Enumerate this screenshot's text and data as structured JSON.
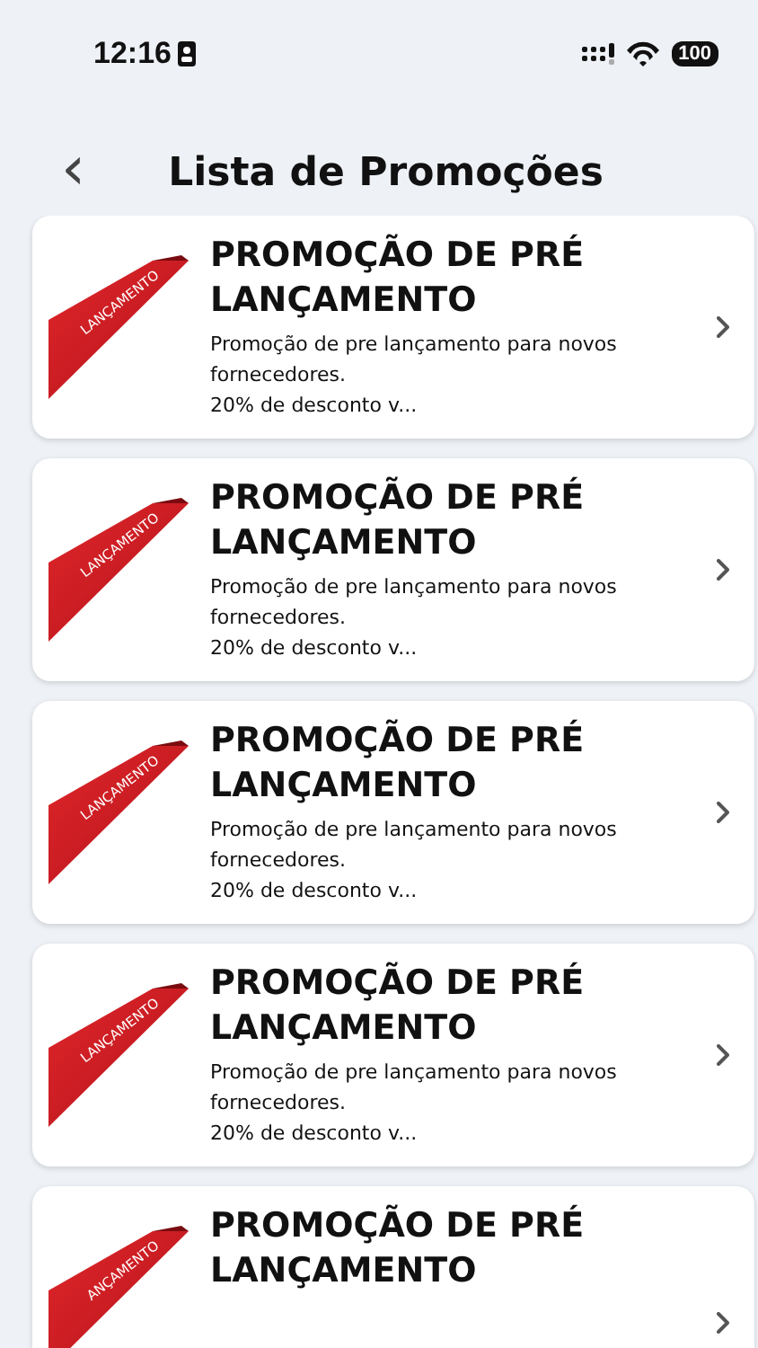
{
  "status_bar": {
    "time": "12:16",
    "battery": "100"
  },
  "header": {
    "back": "‹",
    "title": "Lista de Promoções"
  },
  "promotions": [
    {
      "ribbon": "LANÇAMENTO",
      "title": "PROMOÇÃO DE PRÉ LANÇAMENTO",
      "description": [
        "Promoção de pre lançamento para novos fornecedores.",
        "20% de desconto v..."
      ]
    },
    {
      "ribbon": "LANÇAMENTO",
      "title": "PROMOÇÃO DE PRÉ LANÇAMENTO",
      "description": [
        "Promoção de pre lançamento para novos fornecedores.",
        "20% de desconto v..."
      ]
    },
    {
      "ribbon": "LANÇAMENTO",
      "title": "PROMOÇÃO DE PRÉ LANÇAMENTO",
      "description": [
        "Promoção de pre lançamento para novos fornecedores.",
        "20% de desconto v..."
      ]
    },
    {
      "ribbon": "LANÇAMENTO",
      "title": "PROMOÇÃO DE PRÉ LANÇAMENTO",
      "description": [
        "Promoção de pre lançamento para novos fornecedores.",
        "20% de desconto v..."
      ]
    },
    {
      "ribbon": "ANÇAMENTO",
      "title": "PROMOÇÃO DE PRÉ LANÇAMENTO"
    }
  ]
}
